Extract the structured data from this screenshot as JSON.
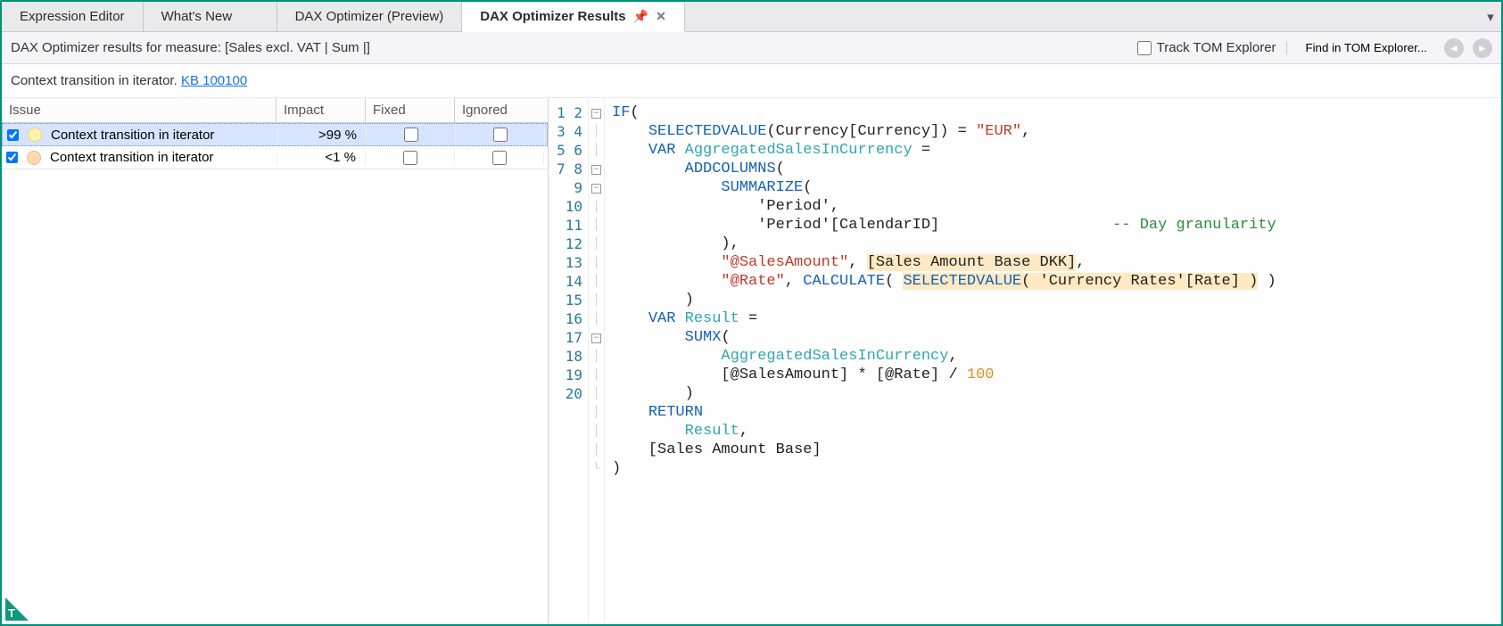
{
  "tabs": {
    "items": [
      {
        "label": "Expression Editor"
      },
      {
        "label": "What's New"
      },
      {
        "label": "DAX Optimizer (Preview)"
      },
      {
        "label": "DAX Optimizer Results"
      }
    ],
    "active_index": 3
  },
  "infobar": {
    "results_for": "DAX Optimizer results for measure: [Sales excl. VAT | Sum |]",
    "track_label": "Track TOM Explorer",
    "find_label": "Find in TOM Explorer..."
  },
  "kb": {
    "prefix": "Context transition in iterator. ",
    "link_text": "KB 100100"
  },
  "issue_table": {
    "headers": {
      "issue": "Issue",
      "impact": "Impact",
      "fixed": "Fixed",
      "ignored": "Ignored"
    },
    "rows": [
      {
        "checked": true,
        "color": "yellow",
        "name": "Context transition in iterator",
        "impact": ">99 %",
        "fixed": false,
        "ignored": false,
        "selected": true
      },
      {
        "checked": true,
        "color": "orange",
        "name": "Context transition in iterator",
        "impact": "<1 %",
        "fixed": false,
        "ignored": false
      }
    ]
  },
  "code": {
    "lines": [
      {
        "n": 1,
        "fold": "open",
        "html": "<span class='kw'>IF</span>("
      },
      {
        "n": 2,
        "fold": "line",
        "html": "    <span class='fn'>SELECTEDVALUE</span>(Currency[Currency]) = <span class='str'>\"EUR\"</span>,"
      },
      {
        "n": 3,
        "fold": "line",
        "html": "    <span class='kw'>VAR</span> <span class='ident'>AggregatedSalesInCurrency</span> ="
      },
      {
        "n": 4,
        "fold": "open",
        "html": "        <span class='fn'>ADDCOLUMNS</span>("
      },
      {
        "n": 5,
        "fold": "open",
        "html": "            <span class='fn'>SUMMARIZE</span>("
      },
      {
        "n": 6,
        "fold": "line",
        "html": "                'Period',"
      },
      {
        "n": 7,
        "fold": "line",
        "html": "                'Period'[CalendarID]                   <span class='comment'>-- Day granularity</span>"
      },
      {
        "n": 8,
        "fold": "line",
        "html": "            ),"
      },
      {
        "n": 9,
        "fold": "line",
        "html": "            <span class='str'>\"@SalesAmount\"</span>, <span class='hl'>[Sales Amount Base DKK]</span>,"
      },
      {
        "n": 10,
        "fold": "line",
        "html": "            <span class='str'>\"@Rate\"</span>, <span class='fn'>CALCULATE</span>( <span class='hl'><span class='fn'>SELECTEDVALUE</span>( 'Currency Rates'[Rate] )</span> )"
      },
      {
        "n": 11,
        "fold": "line",
        "html": "        )"
      },
      {
        "n": 12,
        "fold": "line",
        "html": "    <span class='kw'>VAR</span> <span class='ident'>Result</span> ="
      },
      {
        "n": 13,
        "fold": "open",
        "html": "        <span class='fn'>SUMX</span>("
      },
      {
        "n": 14,
        "fold": "line",
        "html": "            <span class='ident'>AggregatedSalesInCurrency</span>,"
      },
      {
        "n": 15,
        "fold": "line",
        "html": "            [@SalesAmount] * [@Rate] / <span class='num'>100</span>"
      },
      {
        "n": 16,
        "fold": "line",
        "html": "        )"
      },
      {
        "n": 17,
        "fold": "line",
        "html": "    <span class='kw'>RETURN</span>"
      },
      {
        "n": 18,
        "fold": "line",
        "html": "        <span class='ident'>Result</span>,"
      },
      {
        "n": 19,
        "fold": "line",
        "html": "    [Sales Amount Base]"
      },
      {
        "n": 20,
        "fold": "close",
        "html": ")"
      }
    ]
  }
}
